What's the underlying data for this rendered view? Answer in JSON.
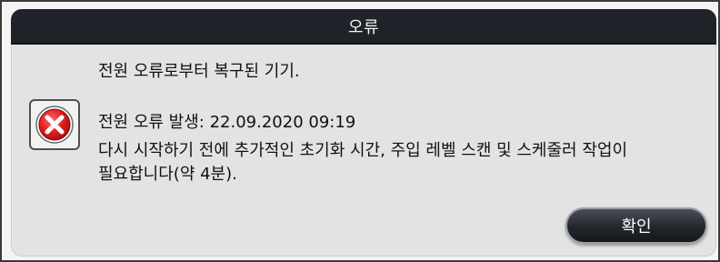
{
  "dialog": {
    "title": "오류",
    "messages": {
      "line1": "전원 오류로부터 복구된 기기.",
      "line2": "전원 오류 발생: 22.09.2020 09:19",
      "line3": "다시 시작하기 전에 추가적인 초기화 시간, 주입 레벨 스캔 및 스케줄러 작업이\n필요합니다(약 4분)."
    },
    "icon": "error-icon",
    "confirm_label": "확인"
  },
  "colors": {
    "titlebar": "#1f2229",
    "dialog_bg": "#e3e3e3",
    "error_red": "#e01f1f",
    "button_dark": "#23262c"
  }
}
